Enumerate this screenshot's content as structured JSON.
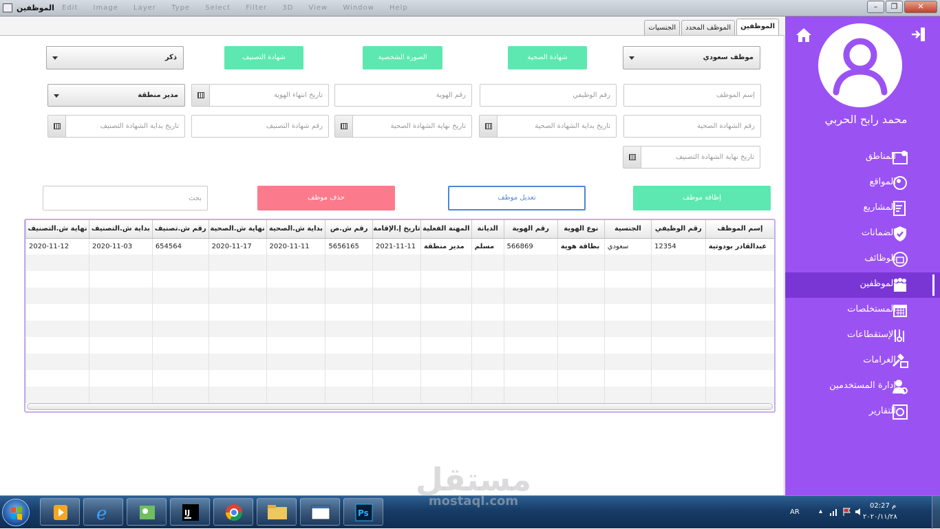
{
  "window": {
    "title": "الموظفين",
    "menu": "Edit  Image  Layer  Type  Select  Filter  3D  View  Window  Help"
  },
  "tabs": [
    {
      "label": "الموظفين",
      "active": true
    },
    {
      "label": "الموظف المحدد",
      "active": false
    },
    {
      "label": "الجنسيات",
      "active": false
    }
  ],
  "form": {
    "employee_type_select": "موظف سعودي",
    "gender_select": "ذكر",
    "job_select": "مدير منطقة",
    "health_cert_button": "شهادة الصحية",
    "photo_button": "الصورة الشخصية",
    "class_cert_button": "شهادة التصنيف",
    "employee_name_ph": "إسم الموظف",
    "job_number_ph": "رقم الوظيفي",
    "id_number_ph": "رقم الهوية",
    "id_expiry_ph": "تاريخ انتهاء الهوية",
    "health_cert_number_ph": "رقم الشهادة الصحية",
    "health_cert_start_ph": "تاريخ بداية الشهادة الصحية",
    "health_cert_end_ph": "تاريخ نهاية الشهادة الصحية",
    "class_cert_number_ph": "رقم شهادة التصنيف",
    "class_cert_start_ph": "تاريخ بداية الشهادة التصنيف",
    "class_cert_end_ph": "تاريخ نهاية الشهادة التصنيف"
  },
  "actions": {
    "add": "إظافة موظف",
    "edit": "تعديل موظف",
    "delete": "حذف موظف",
    "search_ph": "بحث"
  },
  "table": {
    "columns": [
      "إسم الموظف",
      "رقم الوظيفي",
      "الجنسية",
      "نوع الهوية",
      "رقم الهوية",
      "الديانة",
      "المهنة الفعلية",
      "تاريخ إ.الإقامة",
      "رقم ش.ص",
      "بداية ش.الصحية",
      "نهاية ش.الصحية",
      "رقم ش.تصنيف",
      "بداية ش.التصنيف",
      "نهاية ش.التصنيف"
    ],
    "rows": [
      [
        "عبدالقادر بودوتية",
        "12354",
        "سعودي",
        "بطاقة هوية",
        "566869",
        "مسلم",
        "مدير منطقة",
        "2021-11-11",
        "5656165",
        "2020-11-11",
        "2020-11-17",
        "654564",
        "2020-11-03",
        "2020-11-12"
      ]
    ]
  },
  "sidebar": {
    "user_name": "محمد رابح الحربي",
    "items": [
      {
        "label": "المناطق",
        "icon": "map-icon"
      },
      {
        "label": "المواقع",
        "icon": "location-icon"
      },
      {
        "label": "المشاريع",
        "icon": "projects-icon"
      },
      {
        "label": "الضمانات",
        "icon": "shield-icon"
      },
      {
        "label": "الوظائف",
        "icon": "jobs-icon"
      },
      {
        "label": "الموظفين",
        "icon": "employees-icon",
        "active": true
      },
      {
        "label": "المستخلصات",
        "icon": "calendar-icon"
      },
      {
        "label": "الإستقطاعات",
        "icon": "deductions-icon"
      },
      {
        "label": "الغرامات",
        "icon": "fines-icon"
      },
      {
        "label": "إدارة المستخدمين",
        "icon": "user-admin-icon"
      },
      {
        "label": "التقارير",
        "icon": "reports-icon"
      }
    ]
  },
  "taskbar": {
    "lang": "AR",
    "time": "02:27 م",
    "date": "٢٠٢٠/١١/٢٨"
  },
  "watermark": {
    "arabic": "مستقل",
    "latin": "mostaql.com"
  }
}
